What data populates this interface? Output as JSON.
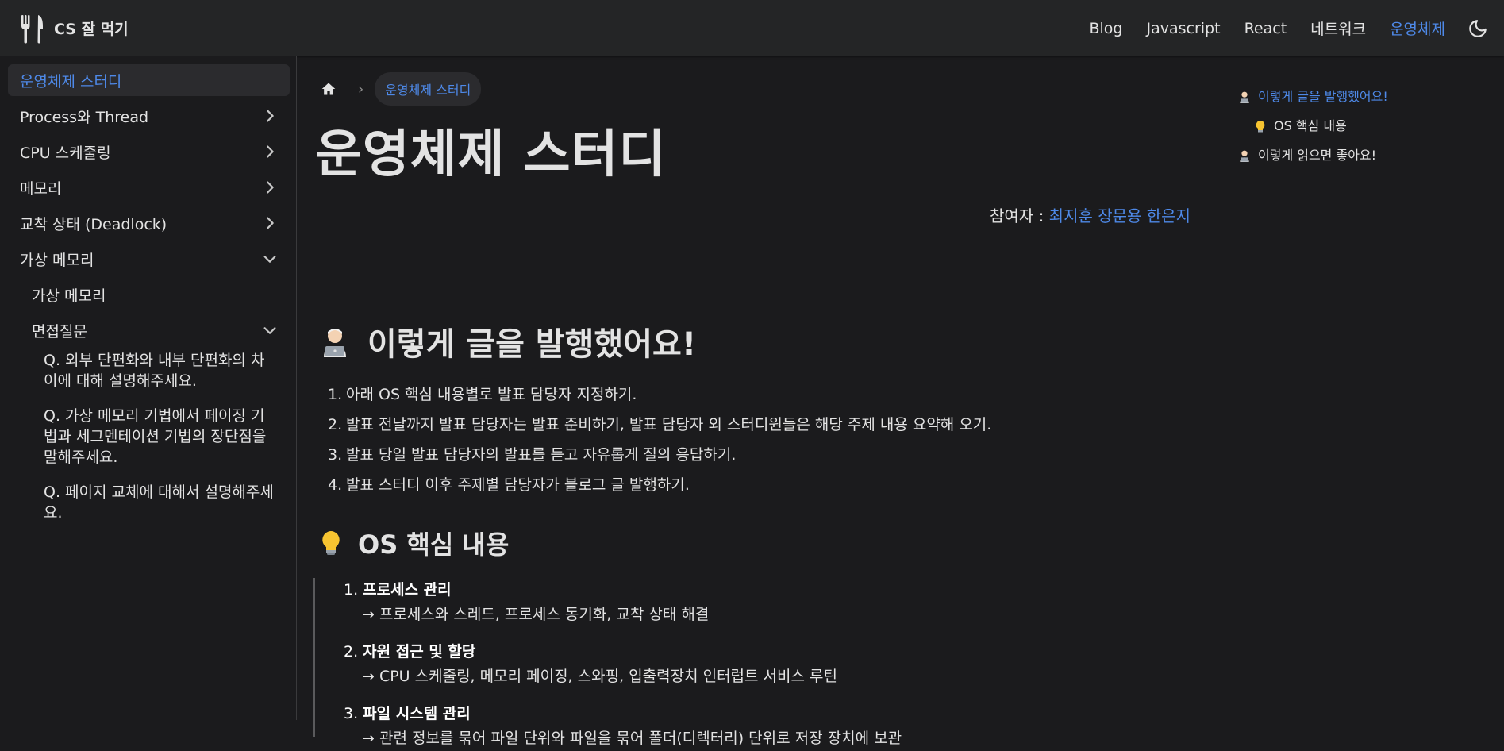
{
  "navbar": {
    "brand_title": "CS 잘 먹기",
    "links": [
      "Blog",
      "Javascript",
      "React",
      "네트워크",
      "운영체제"
    ],
    "active_link": "운영체제"
  },
  "sidebar": {
    "items": [
      {
        "label": "운영체제 스터디"
      },
      {
        "label": "Process와 Thread"
      },
      {
        "label": "CPU 스케줄링"
      },
      {
        "label": "메모리"
      },
      {
        "label": "교착 상태 (Deadlock)"
      },
      {
        "label": "가상 메모리"
      },
      {
        "label": "가상 메모리"
      },
      {
        "label": "면접질문"
      },
      {
        "label": "Q. 외부 단편화와 내부 단편화의 차이에 대해 설명해주세요."
      },
      {
        "label": "Q. 가상 메모리 기법에서 페이징 기법과 세그멘테이션 기법의 장단점을 말해주세요."
      },
      {
        "label": "Q. 페이지 교체에 대해서 설명해주세요."
      }
    ]
  },
  "breadcrumb": {
    "current": "운영체제 스터디"
  },
  "page": {
    "title": "운영체제 스터디",
    "participants_label": "참여자 : ",
    "participants_names": "최지훈 장문용 한은지"
  },
  "section1": {
    "heading": "이렇게 글을 발행했어요!",
    "items": [
      "아래 OS 핵심 내용별로 발표 담당자 지정하기.",
      "발표 전날까지 발표 담당자는 발표 준비하기, 발표 담당자 외 스터디원들은 해당 주제 내용 요약해 오기.",
      "발표 당일 발표 담당자의 발표를 듣고 자유롭게 질의 응답하기.",
      "발표 스터디 이후 주제별 담당자가 블로그 글 발행하기."
    ]
  },
  "section2": {
    "heading": "OS 핵심 내용",
    "items": [
      {
        "title": "프로세스 관리",
        "desc": "→ 프로세스와 스레드, 프로세스 동기화, 교착 상태 해결"
      },
      {
        "title": "자원 접근 및 할당",
        "desc": "→ CPU 스케줄링, 메모리 페이징, 스와핑, 입출력장치 인터럽트 서비스 루틴"
      },
      {
        "title": "파일 시스템 관리",
        "desc": "→ 관련 정보를 묶어 파일 단위와 파일을 묶어 폴더(디렉터리) 단위로 저장 장치에 보관"
      }
    ]
  },
  "toc": {
    "items": [
      "이렇게 글을 발행했어요!",
      "OS 핵심 내용",
      "이렇게 읽으면 좋아요!"
    ]
  },
  "colors": {
    "accent": "#4e89e8",
    "background": "#1b1b1d",
    "navbar": "#242526"
  },
  "icons": {
    "brand": "fork-knife-icon",
    "theme": "moon-icon",
    "home": "home-icon",
    "section1": "technologist-emoji",
    "section2": "light-bulb-emoji"
  }
}
